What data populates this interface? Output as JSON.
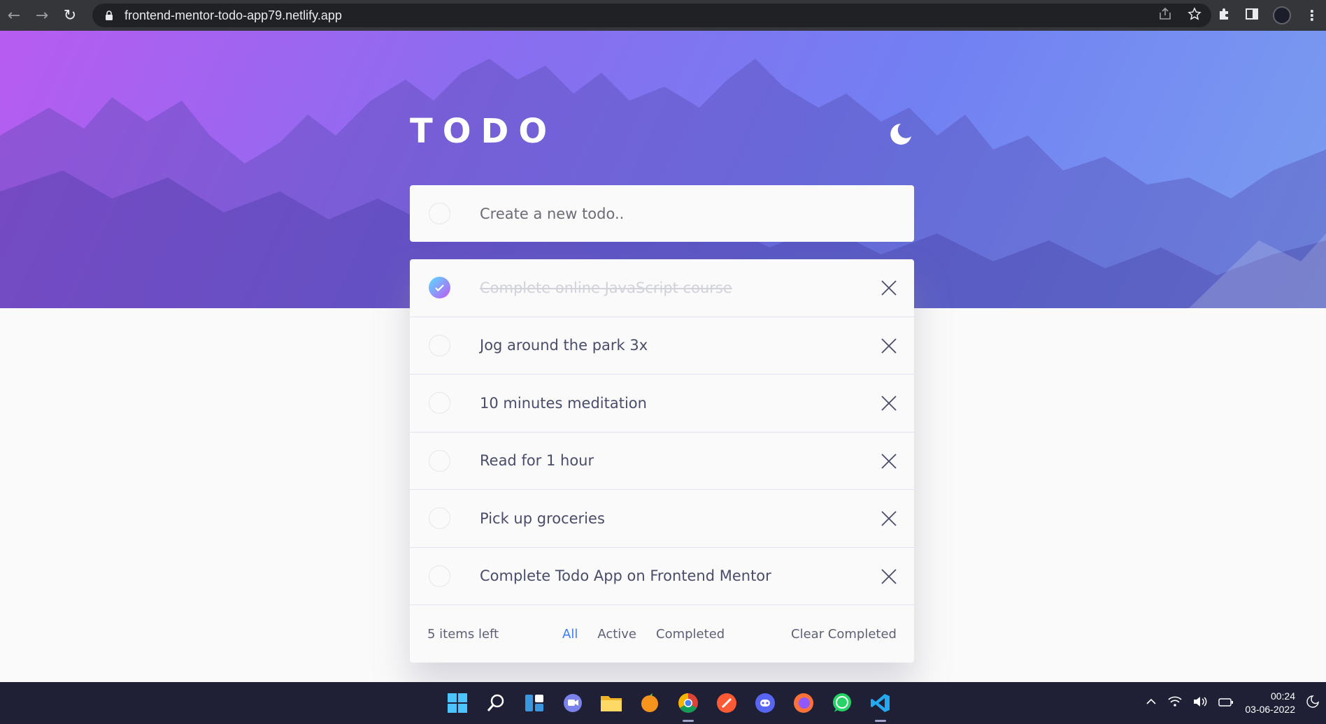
{
  "browser": {
    "url": "frontend-mentor-todo-app79.netlify.app"
  },
  "app": {
    "title": "TODO",
    "new_todo_placeholder": "Create a new todo.."
  },
  "todos": [
    {
      "text": "Complete online JavaScript course",
      "completed": true
    },
    {
      "text": "Jog around the park 3x",
      "completed": false
    },
    {
      "text": "10 minutes meditation",
      "completed": false
    },
    {
      "text": "Read for 1 hour",
      "completed": false
    },
    {
      "text": "Pick up groceries",
      "completed": false
    },
    {
      "text": "Complete Todo App on Frontend Mentor",
      "completed": false
    }
  ],
  "footer": {
    "items_left": "5 items left",
    "filters": [
      "All",
      "Active",
      "Completed"
    ],
    "active_filter": "All",
    "clear_label": "Clear Completed"
  },
  "taskbar": {
    "time": "00:24",
    "date": "03-06-2022",
    "apps": [
      "start-icon",
      "search-icon",
      "widgets-icon",
      "teams-chat-icon",
      "file-explorer-icon",
      "fl-studio-icon",
      "chrome-icon",
      "brave-icon",
      "discord-icon",
      "firefox-icon",
      "whatsapp-icon",
      "vscode-icon"
    ]
  },
  "colors": {
    "accent_blue": "#3a7cfd",
    "check_gradient_start": "#57ddff",
    "check_gradient_end": "#c058f3",
    "hero_start": "#b75cf0",
    "hero_end": "#7a9ef0"
  }
}
